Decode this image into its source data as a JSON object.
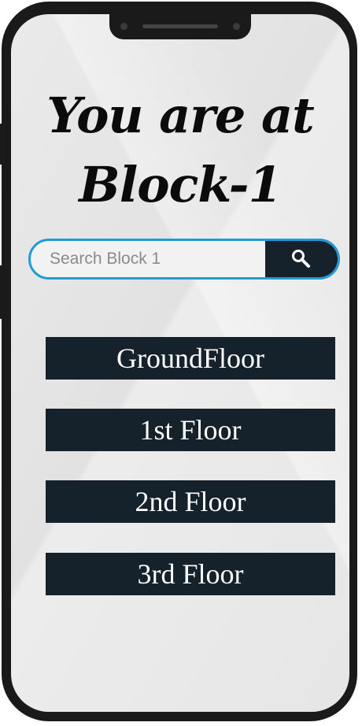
{
  "heading": {
    "line1": "You are at",
    "line2": "Block-1"
  },
  "search": {
    "placeholder": "Search Block 1",
    "button_icon": "search-icon",
    "border_color": "#1f9bd7"
  },
  "floors": [
    {
      "label": "GroundFloor"
    },
    {
      "label": "1st Floor"
    },
    {
      "label": "2nd Floor"
    },
    {
      "label": "3rd Floor"
    }
  ],
  "colors": {
    "button_bg": "#15212b",
    "button_text": "#ffffff",
    "screen_bg": "#e6e6e6",
    "frame": "#1a1a1a"
  }
}
